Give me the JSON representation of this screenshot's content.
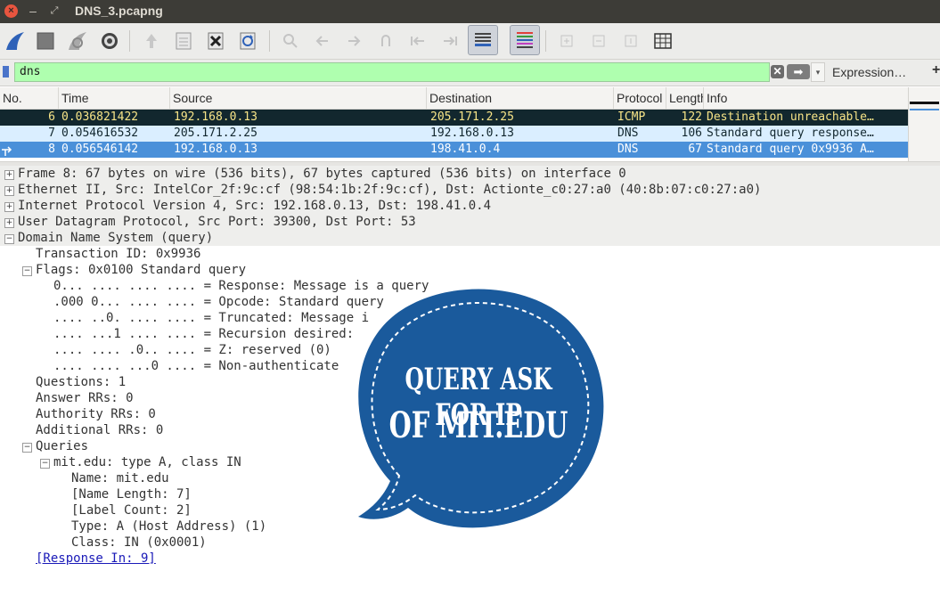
{
  "window": {
    "title": "DNS_3.pcapng",
    "close_glyph": "×",
    "minimize_glyph": "–",
    "maximize_glyph": "⤢"
  },
  "toolbar": {
    "icons": [
      "shark-fin-start-icon",
      "stop-square-icon",
      "shark-fin-restart-icon",
      "gear-options-icon",
      "open-file-icon",
      "save-file-icon",
      "close-file-icon",
      "reload-icon",
      "search-icon",
      "back-arrow-icon",
      "forward-arrow-icon",
      "go-to-packet-icon",
      "first-packet-icon",
      "last-packet-icon",
      "autoscroll-icon",
      "colorize-icon",
      "zoom-in-icon",
      "zoom-out-icon",
      "normal-size-icon",
      "resize-columns-icon"
    ]
  },
  "filter": {
    "value": "dns",
    "clear_glyph": "✕",
    "apply_glyph": "➡",
    "dropdown_glyph": "▾",
    "expression_label": "Expression…",
    "plus_label": "+"
  },
  "packet_list": {
    "columns": [
      "No.",
      "Time",
      "Source",
      "Destination",
      "Protocol",
      "Length",
      "Info"
    ],
    "rows": [
      {
        "no": "6",
        "time": "0.036821422",
        "source": "192.168.0.13",
        "destination": "205.171.2.25",
        "protocol": "ICMP",
        "length": "122",
        "info": "Destination unreachable…",
        "style": "icmp"
      },
      {
        "no": "7",
        "time": "0.054616532",
        "source": "205.171.2.25",
        "destination": "192.168.0.13",
        "protocol": "DNS",
        "length": "106",
        "info": "Standard query response…",
        "style": "dns"
      },
      {
        "no": "8",
        "time": "0.056546142",
        "source": "192.168.0.13",
        "destination": "198.41.0.4",
        "protocol": "DNS",
        "length": "67",
        "info": "Standard query 0x9936 A…",
        "style": "selected"
      }
    ]
  },
  "details": {
    "frame": "Frame 8: 67 bytes on wire (536 bits), 67 bytes captured (536 bits) on interface 0",
    "ethernet": "Ethernet II, Src: IntelCor_2f:9c:cf (98:54:1b:2f:9c:cf), Dst: Actionte_c0:27:a0 (40:8b:07:c0:27:a0)",
    "ip": "Internet Protocol Version 4, Src: 192.168.0.13, Dst: 198.41.0.4",
    "udp": "User Datagram Protocol, Src Port: 39300, Dst Port: 53",
    "dns": "Domain Name System (query)",
    "transaction_id": "Transaction ID: 0x9936",
    "flags": "Flags: 0x0100 Standard query",
    "flag_bits": [
      "0... .... .... .... = Response: Message is a query",
      ".000 0... .... .... = Opcode: Standard query",
      ".... ..0. .... .... = Truncated: Message i",
      ".... ...1 .... .... = Recursion desired:",
      ".... .... .0.. .... = Z: reserved (0)",
      ".... .... ...0 .... = Non-authenticate"
    ],
    "questions": "Questions: 1",
    "answer_rrs": "Answer RRs: 0",
    "authority_rrs": "Authority RRs: 0",
    "additional_rrs": "Additional RRs: 0",
    "queries": "Queries",
    "query_entry": "mit.edu: type A, class IN",
    "query_fields": [
      "Name: mit.edu",
      "[Name Length: 7]",
      "[Label Count: 2]",
      "Type: A (Host Address) (1)",
      "Class: IN (0x0001)"
    ],
    "response_link": "[Response In: 9]",
    "expanded_glyph": "−",
    "collapsed_glyph": "+"
  },
  "sticker": {
    "line1": "QUERY ASK FOR IP",
    "line2": "OF MIT.EDU",
    "color": "#1a5a9c"
  }
}
